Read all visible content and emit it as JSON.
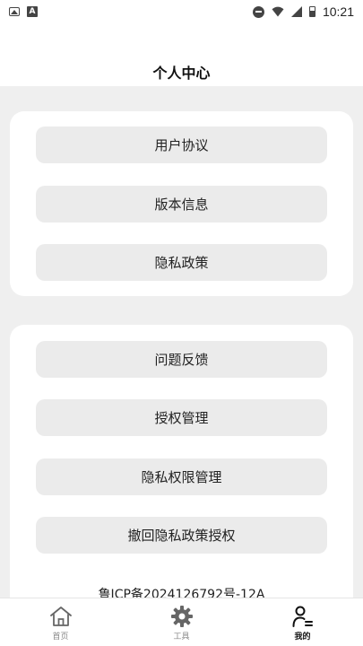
{
  "status_bar": {
    "time": "10:21",
    "left_icons": [
      "image-notification-icon",
      "a-notification-icon"
    ],
    "right_icons": [
      "do-not-disturb-icon",
      "wifi-icon",
      "cellular-signal-icon",
      "battery-icon"
    ]
  },
  "header": {
    "title": "个人中心"
  },
  "card_1": {
    "items": [
      {
        "label": "用户协议"
      },
      {
        "label": "版本信息"
      },
      {
        "label": "隐私政策"
      }
    ]
  },
  "card_2": {
    "items": [
      {
        "label": "问题反馈"
      },
      {
        "label": "授权管理"
      },
      {
        "label": "隐私权限管理"
      },
      {
        "label": "撤回隐私政策授权"
      }
    ],
    "icp": "鲁ICP备2024126792号-12A"
  },
  "tab_bar": {
    "tabs": [
      {
        "label": "首页",
        "icon": "home-icon"
      },
      {
        "label": "工具",
        "icon": "gear-icon"
      },
      {
        "label": "我的",
        "icon": "profile-icon",
        "active": true
      }
    ]
  },
  "colors": {
    "page_bg": "#efefef",
    "card_bg": "#ffffff",
    "button_bg": "#ebebeb",
    "active_tab": "#111111",
    "inactive_tab": "#888888"
  }
}
